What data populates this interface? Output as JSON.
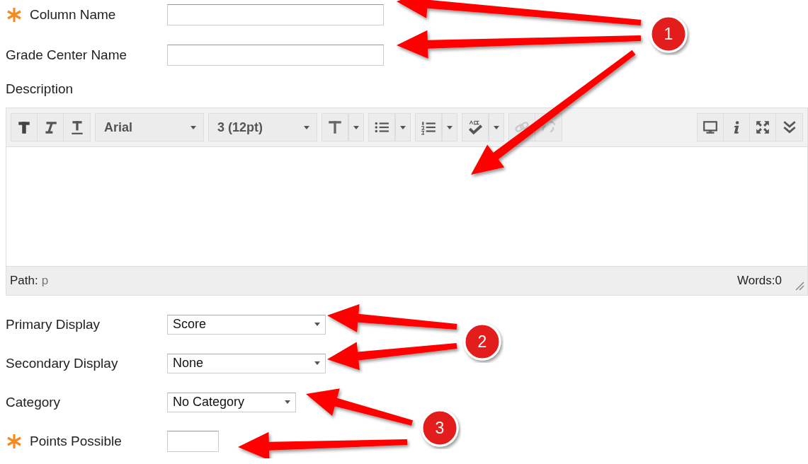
{
  "fields": [
    {
      "label": "Column Name",
      "required": true,
      "kind": "text"
    },
    {
      "label": "Grade Center Name",
      "required": false,
      "kind": "text"
    }
  ],
  "description": {
    "label": "Description",
    "toolbar": [
      {
        "kind": "bold",
        "disabled": false
      },
      {
        "kind": "italic",
        "disabled": false
      },
      {
        "kind": "underline",
        "disabled": false
      },
      {
        "kind": "font",
        "value": "Arial"
      },
      {
        "kind": "size",
        "value": "3 (12pt)"
      },
      {
        "kind": "text-color",
        "disabled": false
      },
      {
        "kind": "bullets",
        "disabled": false
      },
      {
        "kind": "numbering",
        "disabled": false
      },
      {
        "kind": "spellcheck",
        "disabled": false
      },
      {
        "kind": "link",
        "disabled": true
      },
      {
        "kind": "unlink",
        "disabled": true
      },
      {
        "kind": "spacer"
      },
      {
        "kind": "preview",
        "disabled": false
      },
      {
        "kind": "info",
        "disabled": false
      },
      {
        "kind": "fullscreen",
        "disabled": false
      },
      {
        "kind": "more",
        "disabled": false
      }
    ],
    "status": {
      "path_label": "Path:",
      "path": "p",
      "words": "Words:0"
    }
  },
  "options": [
    {
      "label": "Primary Display",
      "required": false,
      "kind": "select",
      "value": "Score"
    },
    {
      "label": "Secondary Display",
      "required": false,
      "kind": "select",
      "value": "None"
    },
    {
      "label": "Category",
      "required": false,
      "kind": "select",
      "value": "No Category"
    },
    {
      "label": "Points Possible",
      "required": true,
      "kind": "text"
    }
  ],
  "callouts": [
    {
      "number": "1"
    },
    {
      "number": "2"
    },
    {
      "number": "3"
    }
  ]
}
